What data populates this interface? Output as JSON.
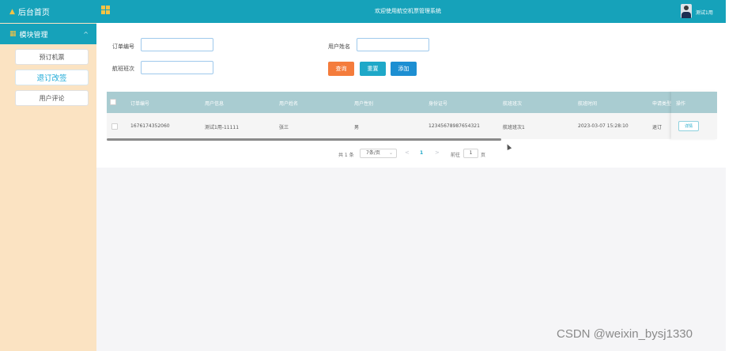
{
  "sidebar": {
    "home_label": "后台首页",
    "group_label": "模块管理",
    "group_chevron": "^",
    "items": [
      {
        "label": "预订机票"
      },
      {
        "label": "退订改签"
      },
      {
        "label": "用户评论"
      }
    ]
  },
  "topbar": {
    "title": "欢迎使用航空机票管理系统",
    "username": "测试1用"
  },
  "search": {
    "order_no_label": "订单编号",
    "order_no_value": "",
    "user_name_label": "用户姓名",
    "user_name_value": "",
    "flight_label": "航班班次",
    "flight_value": ""
  },
  "buttons": {
    "query": "查询",
    "reset": "重置",
    "add": "添加"
  },
  "table": {
    "columns": [
      "订单编号",
      "用户信息",
      "用户姓名",
      "用户性别",
      "身份证号",
      "航班班次",
      "航班时间",
      "申请类型",
      "操作"
    ],
    "rows": [
      {
        "order_no": "1676174352060",
        "user_info": "测试1用-11111",
        "user_name": "张三",
        "gender": "男",
        "id_card": "12345678987654321",
        "flight": "航班班次1",
        "flight_time": "2023-03-07 15:28:10",
        "apply_type": "退订",
        "action": "详情"
      }
    ]
  },
  "pagination": {
    "total": "共 1 条",
    "page_size": "7条/页",
    "prev": "<",
    "next": ">",
    "current": "1",
    "goto_label": "前往",
    "goto_value": "1",
    "page_suffix": "页"
  },
  "watermark": "CSDN @weixin_bysj1330",
  "colors": {
    "primary": "#16a2ba",
    "sidebar_bg": "#fbe3c2",
    "query_button": "#f47c3c",
    "reset_button": "#1ea8c8",
    "add_button": "#1d8fd2",
    "table_header": "#a9ccd1"
  }
}
